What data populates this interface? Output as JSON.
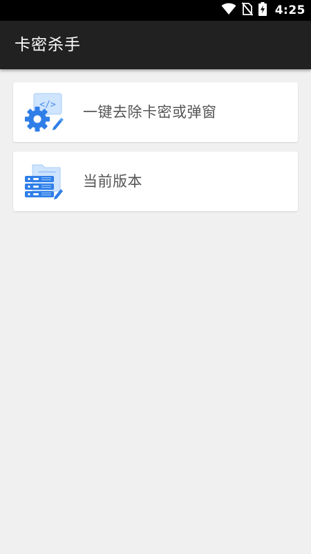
{
  "status_bar": {
    "time": "4:25",
    "icons": [
      "wifi-icon",
      "no-sim-icon",
      "battery-charging-icon"
    ]
  },
  "app_bar": {
    "title": "卡密杀手"
  },
  "menu": {
    "items": [
      {
        "label": "一键去除卡密或弹窗",
        "icon": "settings-gear-code-icon"
      },
      {
        "label": "当前版本",
        "icon": "server-folder-icon"
      }
    ]
  },
  "colors": {
    "status_bar_bg": "#000000",
    "app_bar_bg": "#212121",
    "page_bg": "#f0f0f0",
    "card_bg": "#ffffff",
    "label_text": "#555555",
    "icon_blue": "#2f7ee8",
    "icon_light_blue": "#bcd9fb"
  }
}
